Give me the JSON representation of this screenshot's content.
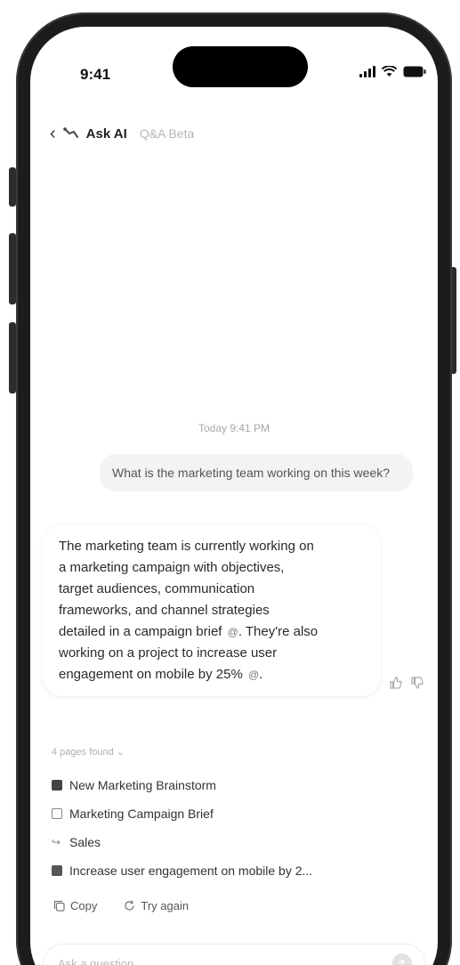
{
  "status_bar": {
    "time": "9:41"
  },
  "header": {
    "back_icon": "chevron-left-icon",
    "title": "Ask AI",
    "subtitle": "Q&A Beta"
  },
  "chat": {
    "timestamp": "Today 9:41 PM",
    "user_message": "What is the marketing team working on this week?",
    "ai_response": {
      "lines": [
        "The marketing team is currently working on",
        "a marketing campaign with objectives,",
        "target audiences, communication",
        "frameworks, and channel strategies",
        "detailed in a campaign brief",
        "They're also",
        "working on a project to increase user",
        "engagement on mobile by 25%"
      ],
      "citation_marker": "@"
    },
    "pages_found": "4 pages found",
    "sources": [
      {
        "label": "New Marketing Brainstorm",
        "icon": "page-icon"
      },
      {
        "label": "Marketing Campaign Brief",
        "icon": "document-icon"
      },
      {
        "label": "Sales",
        "icon": "flow-icon"
      },
      {
        "label": "Increase user engagement on mobile by 2...",
        "icon": "page-icon"
      }
    ],
    "actions": {
      "copy": "Copy",
      "try_again": "Try again"
    }
  },
  "composer": {
    "placeholder": "Ask a question..."
  },
  "colors": {
    "accent": "#1c1c1e",
    "bubble": "#f3f3f3",
    "muted": "#b0b0b0"
  }
}
